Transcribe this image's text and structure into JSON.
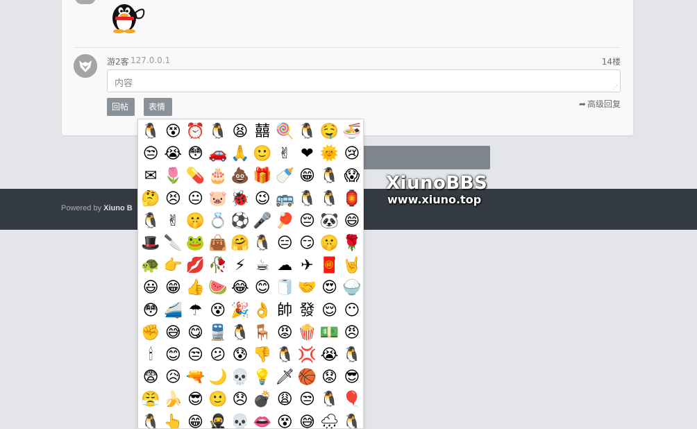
{
  "post": {
    "username": "游2客",
    "ip": "127.0.0.1",
    "floor": "14楼"
  },
  "reply": {
    "placeholder": "内容",
    "submit_label": "回帖",
    "emoji_label": "表情",
    "advanced_label": "高级回复"
  },
  "footer": {
    "powered_prefix": "Powered by ",
    "powered_brand": "Xiuno B"
  },
  "watermark": {
    "line1": "XiunoBBS",
    "line2": "www.xiuno.top"
  },
  "emoji_panel": {
    "glyphs": [
      "🐧",
      "😵",
      "⏰",
      "🐧",
      "😫",
      "囍",
      "🍭",
      "🐧",
      "🤤",
      "🍜",
      "😒",
      "😭",
      "😳",
      "🚗",
      "🙏",
      "🙂",
      "✌",
      "❤",
      "🌞",
      "😢",
      "✉",
      "🌷",
      "💊",
      "🎂",
      "💩",
      "🎁",
      "🍼",
      "😁",
      "🐧",
      "😱",
      "🤔",
      "😣",
      "😐",
      "🐷",
      "🐞",
      "😉",
      "🚌",
      "🐧",
      "🐧",
      "🏮",
      "🐧",
      "✌",
      "🤫",
      "💍",
      "⚽",
      "🎤",
      "🏓",
      "😔",
      "🐼",
      "😄",
      "🎩",
      "🔪",
      "🐸",
      "👜",
      "🤗",
      "🐧",
      "😑",
      "😏",
      "🤫",
      "🌹",
      "🐢",
      "👉",
      "💋",
      "🥀",
      "⚡",
      "☕",
      "☁",
      "✈",
      "🧧",
      "🤘",
      "😃",
      "😁",
      "👍",
      "🍉",
      "😂",
      "😊",
      "🧻",
      "🤝",
      "😍",
      "🍚",
      "😳",
      "🚄",
      "☂",
      "😵",
      "🎉",
      "👌",
      "帥",
      "發",
      "😌",
      "😶",
      "✊",
      "😅",
      "😋",
      "🚆",
      "🐧",
      "🪑",
      "😡",
      "🍿",
      "💵",
      "😠",
      "🕯",
      "😊",
      "😒",
      "😕",
      "😰",
      "👎",
      "🐧",
      "💢",
      "😭",
      "🐧",
      "😨",
      "😥",
      "🔫",
      "🌙",
      "💀",
      "💡",
      "🗡",
      "🏀",
      "😟",
      "😎",
      "😤",
      "🍌",
      "😎",
      "🙂",
      "😞",
      "💣",
      "😩",
      "😒",
      "🐧",
      "🎈",
      "🐧",
      "👆",
      "😁",
      "🥷",
      "💀",
      "👄",
      "😵",
      "😅",
      "🌧",
      "🐧"
    ]
  }
}
